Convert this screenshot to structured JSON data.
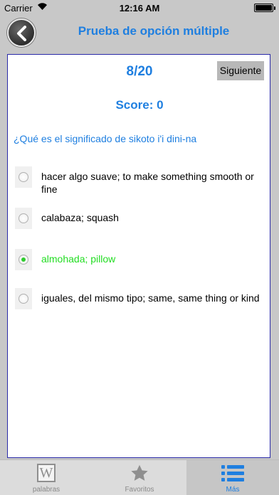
{
  "status": {
    "carrier": "Carrier",
    "time": "12:16 AM"
  },
  "nav": {
    "title": "Prueba de opción múltiple"
  },
  "quiz": {
    "counter": "8/20",
    "next_label": "Siguiente",
    "score": "Score: 0",
    "question": "¿Qué es el significado de sikoto i'i dini-na",
    "options": [
      {
        "label": "hacer algo suave; to make something smooth or fine",
        "selected": false
      },
      {
        "label": "calabaza; squash",
        "selected": false
      },
      {
        "label": "almohada; pillow",
        "selected": true
      },
      {
        "label": "iguales, del mismo tipo; same, same thing or kind",
        "selected": false
      }
    ]
  },
  "tabs": [
    {
      "label": "palabras",
      "icon": "w-tile-icon",
      "active": false
    },
    {
      "label": "Favoritos",
      "icon": "star-icon",
      "active": false
    },
    {
      "label": "Más",
      "icon": "list-icon",
      "active": true
    }
  ],
  "colors": {
    "accent": "#1f7fe0",
    "correct": "#22dd22",
    "card_border": "#2a2aa8",
    "background": "#c8c8c8"
  }
}
